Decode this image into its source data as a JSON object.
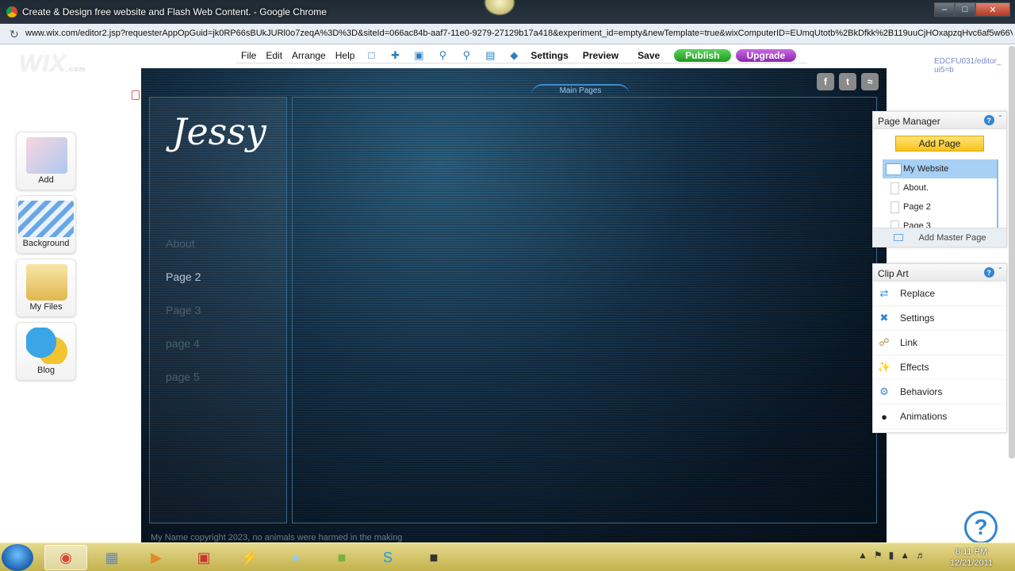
{
  "browser": {
    "title": "Create & Design free website and Flash Web Content. - Google Chrome",
    "url": "www.wix.com/editor2.jsp?requesterAppOpGuid=jk0RP66sBUkJURl0o7zeqA%3D%3D&siteId=066ac84b-aaf7-11e0-9279-27129b17a418&experiment_id=empty&newTemplate=true&wixComputerID=EUmqUtotb%2BkDfkk%2B119uuCjHOxapzqHvc6af5w66V"
  },
  "editor": {
    "logo": "WIX",
    "logo_suffix": ".com",
    "menu": {
      "file": "File",
      "edit": "Edit",
      "arrange": "Arrange",
      "help": "Help"
    },
    "toolbar": {
      "settings": "Settings",
      "preview": "Preview",
      "save": "Save",
      "publish": "Publish",
      "upgrade": "Upgrade"
    },
    "user_id": "EDCFU031/editor_ ui5=b",
    "left_panel": {
      "add": "Add",
      "background": "Background",
      "my_files": "My Files",
      "blog": "Blog"
    }
  },
  "canvas": {
    "main_pages_tab": "Main Pages",
    "site_title": "Jessy",
    "nav": [
      "About",
      "Page 2",
      "Page 3",
      "page 4",
      "page 5"
    ],
    "footer": "My Name copyright 2023, no animals were harmed in the making"
  },
  "page_manager": {
    "title": "Page Manager",
    "add_page": "Add Page",
    "pages": [
      "My Website",
      "About.",
      "Page 2",
      "Page 3"
    ],
    "master_page": "Add Master Page"
  },
  "clip_art": {
    "title": "Clip Art",
    "items": [
      "Replace",
      "Settings",
      "Link",
      "Effects",
      "Behaviors",
      "Animations"
    ]
  },
  "taskbar": {
    "time": "8:11 PM",
    "date": "12/21/2011"
  },
  "colors": {
    "publish": "#1b9a1b",
    "upgrade": "#8a26b0",
    "accent": "#2f86d3",
    "add_page": "#f7c21a"
  }
}
